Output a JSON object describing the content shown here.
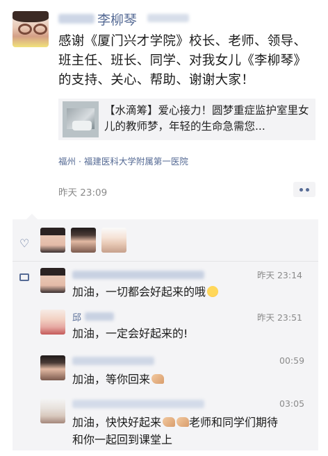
{
  "post": {
    "author_name": "李柳琴",
    "text": "感谢《厦门兴才学院》校长、老师、领导、班主任、班长、同学、对我女儿《李柳琴》的支持、关心、帮助、谢谢大家！",
    "link": {
      "text": "【水滴筹】爱心接力！圆梦重症监护室里女儿的教师梦，年轻的生命急需您..."
    },
    "location": "福州 · 福建医科大学附属第一医院",
    "time": "昨天 23:09"
  },
  "comments": [
    {
      "name": "",
      "time": "昨天 23:14",
      "text": "加油，一切都会好起来的哦",
      "emoji": "smile-face"
    },
    {
      "name": "邱",
      "time": "昨天 23:51",
      "text": "加油，一定会好起来的!",
      "emoji": ""
    },
    {
      "name": "",
      "time": "00:59",
      "text": "加油，等你回来",
      "emoji": "flexed-arm"
    },
    {
      "name": "",
      "time": "03:05",
      "text_line1": "加油，快快好起来",
      "text_line1_tail": "老师和同学们期待",
      "text_line2": "和你一起回到课堂上",
      "emoji": "flexed-arm x2"
    }
  ],
  "colors": {
    "link_blue": "#566b95",
    "comment_bg": "#f4f4f6",
    "time_gray": "#8a8a8a"
  },
  "icons": [
    "heart-icon",
    "comment-icon",
    "more-dots-icon"
  ]
}
